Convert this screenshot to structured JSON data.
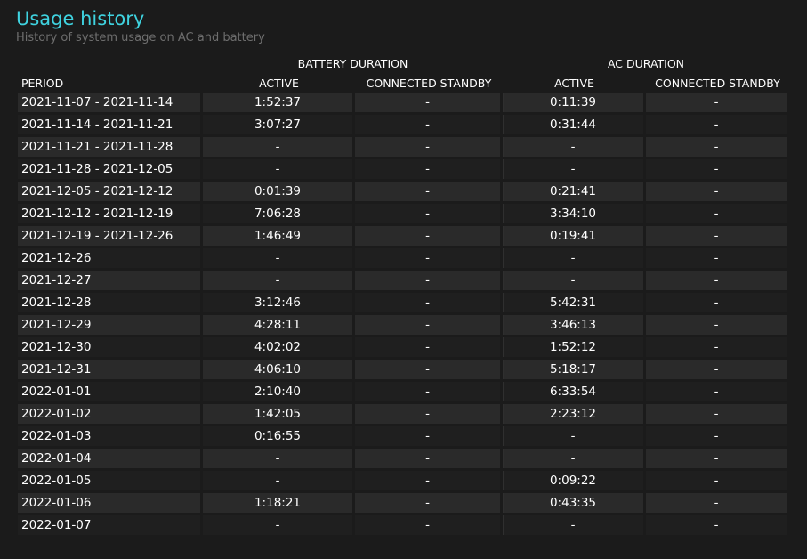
{
  "report": {
    "title": "Usage history",
    "subtitle": "History of system usage on AC and battery"
  },
  "table": {
    "group_headers": {
      "battery": "BATTERY DURATION",
      "ac": "AC DURATION"
    },
    "columns": {
      "period": "PERIOD",
      "battery_active": "ACTIVE",
      "battery_standby": "CONNECTED STANDBY",
      "ac_active": "ACTIVE",
      "ac_standby": "CONNECTED STANDBY"
    },
    "rows": [
      {
        "period": "2021-11-07 - 2021-11-14",
        "battery_active": "1:52:37",
        "battery_standby": "-",
        "ac_active": "0:11:39",
        "ac_standby": "-"
      },
      {
        "period": "2021-11-14 - 2021-11-21",
        "battery_active": "3:07:27",
        "battery_standby": "-",
        "ac_active": "0:31:44",
        "ac_standby": "-"
      },
      {
        "period": "2021-11-21 - 2021-11-28",
        "battery_active": "-",
        "battery_standby": "-",
        "ac_active": "-",
        "ac_standby": "-"
      },
      {
        "period": "2021-11-28 - 2021-12-05",
        "battery_active": "-",
        "battery_standby": "-",
        "ac_active": "-",
        "ac_standby": "-"
      },
      {
        "period": "2021-12-05 - 2021-12-12",
        "battery_active": "0:01:39",
        "battery_standby": "-",
        "ac_active": "0:21:41",
        "ac_standby": "-"
      },
      {
        "period": "2021-12-12 - 2021-12-19",
        "battery_active": "7:06:28",
        "battery_standby": "-",
        "ac_active": "3:34:10",
        "ac_standby": "-"
      },
      {
        "period": "2021-12-19 - 2021-12-26",
        "battery_active": "1:46:49",
        "battery_standby": "-",
        "ac_active": "0:19:41",
        "ac_standby": "-"
      },
      {
        "period": "2021-12-26",
        "battery_active": "-",
        "battery_standby": "-",
        "ac_active": "-",
        "ac_standby": "-"
      },
      {
        "period": "2021-12-27",
        "battery_active": "-",
        "battery_standby": "-",
        "ac_active": "-",
        "ac_standby": "-"
      },
      {
        "period": "2021-12-28",
        "battery_active": "3:12:46",
        "battery_standby": "-",
        "ac_active": "5:42:31",
        "ac_standby": "-"
      },
      {
        "period": "2021-12-29",
        "battery_active": "4:28:11",
        "battery_standby": "-",
        "ac_active": "3:46:13",
        "ac_standby": "-"
      },
      {
        "period": "2021-12-30",
        "battery_active": "4:02:02",
        "battery_standby": "-",
        "ac_active": "1:52:12",
        "ac_standby": "-"
      },
      {
        "period": "2021-12-31",
        "battery_active": "4:06:10",
        "battery_standby": "-",
        "ac_active": "5:18:17",
        "ac_standby": "-"
      },
      {
        "period": "2022-01-01",
        "battery_active": "2:10:40",
        "battery_standby": "-",
        "ac_active": "6:33:54",
        "ac_standby": "-"
      },
      {
        "period": "2022-01-02",
        "battery_active": "1:42:05",
        "battery_standby": "-",
        "ac_active": "2:23:12",
        "ac_standby": "-"
      },
      {
        "period": "2022-01-03",
        "battery_active": "0:16:55",
        "battery_standby": "-",
        "ac_active": "-",
        "ac_standby": "-"
      },
      {
        "period": "2022-01-04",
        "battery_active": "-",
        "battery_standby": "-",
        "ac_active": "-",
        "ac_standby": "-"
      },
      {
        "period": "2022-01-05",
        "battery_active": "-",
        "battery_standby": "-",
        "ac_active": "0:09:22",
        "ac_standby": "-"
      },
      {
        "period": "2022-01-06",
        "battery_active": "1:18:21",
        "battery_standby": "-",
        "ac_active": "0:43:35",
        "ac_standby": "-"
      },
      {
        "period": "2022-01-07",
        "battery_active": "-",
        "battery_standby": "-",
        "ac_active": "-",
        "ac_standby": "-"
      }
    ]
  },
  "colors": {
    "background": "#1b1b1b",
    "title": "#3fd3e0",
    "subtitle": "#6e6e6e",
    "row_even": "#2a2a2a",
    "row_odd": "#1f1f1f",
    "text": "#ffffff"
  }
}
